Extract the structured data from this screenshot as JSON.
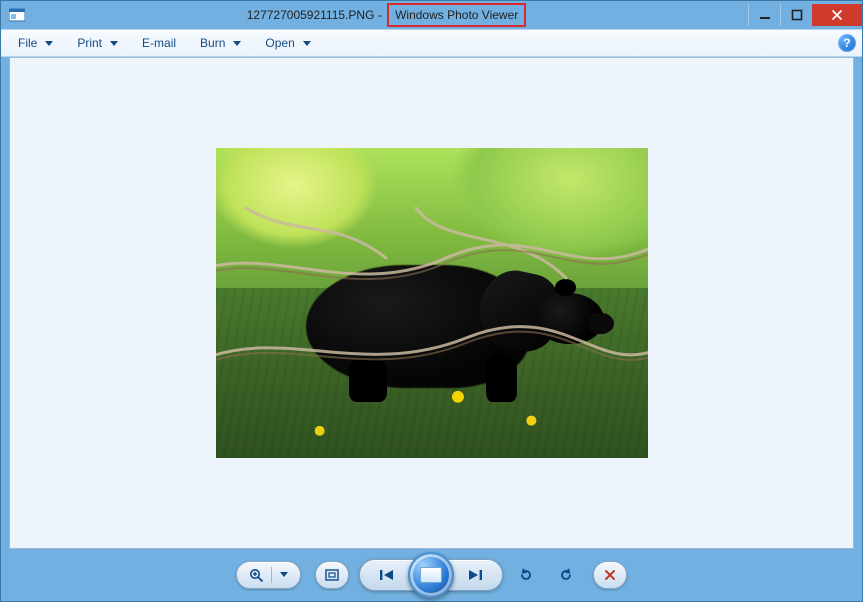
{
  "titlebar": {
    "filename": "127727005921115.PNG",
    "separator": " - ",
    "appname": "Windows Photo Viewer"
  },
  "menu": {
    "file": "File",
    "print": "Print",
    "email": "E-mail",
    "burn": "Burn",
    "open": "Open"
  },
  "icons": {
    "system": "photo-app-icon",
    "help": "?"
  }
}
